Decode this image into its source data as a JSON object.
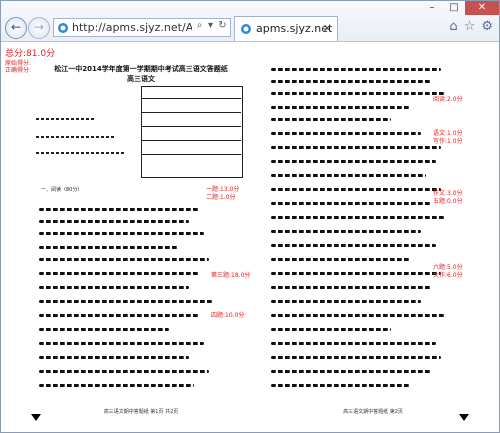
{
  "browser": {
    "address_url": "http://apms.sjyz.net/APMS_P",
    "tab_title": "apms.sjyz.net",
    "window_controls": [
      "minimize",
      "maximize",
      "close"
    ]
  },
  "document": {
    "total_score": "总分:81.0分",
    "left_page": {
      "title": "松江一中2014学年度第一学期期中考试高三语文答题纸",
      "subtitle": "高三语文",
      "section1": "一、阅读（80分）",
      "footer": "高三语文期中答题纸  第1页 共2页"
    },
    "right_page": {
      "footer": "高三语文期中答题纸  第2页"
    },
    "marks": [
      "原始得分:14.0分",
      "正确得分:6.0分",
      "一题:13.0分",
      "二题:1.0分",
      "第三题:18.0分",
      "四题:10.0分",
      "阅读:2.0分",
      "语文:1.0分",
      "写作:1.0分",
      "作文:3.0分",
      "五题:0.0分",
      "六题:5.0分",
      "大作:6.0分"
    ]
  }
}
